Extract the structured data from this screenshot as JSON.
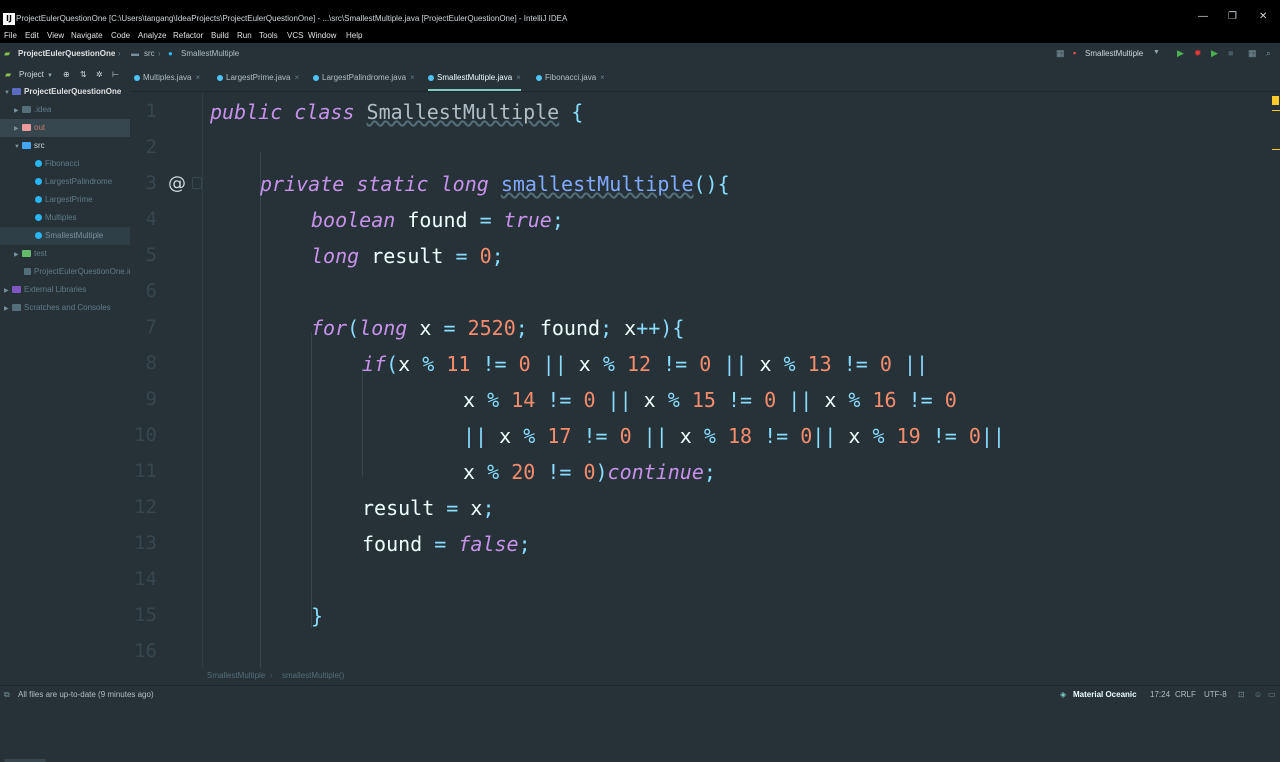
{
  "window": {
    "title": "ProjectEulerQuestionOne [C:\\Users\\tangang\\IdeaProjects\\ProjectEulerQuestionOne] - ...\\src\\SmallestMultiple.java [ProjectEulerQuestionOne] - IntelliJ IDEA",
    "controls": {
      "minimize": "—",
      "maximize": "❐",
      "close": "✕"
    }
  },
  "menu": [
    "File",
    "Edit",
    "View",
    "Navigate",
    "Code",
    "Analyze",
    "Refactor",
    "Build",
    "Run",
    "Tools",
    "VCS",
    "Window",
    "Help"
  ],
  "nav": {
    "project": "ProjectEulerQuestionOne",
    "folder": "src",
    "file": "SmallestMultiple",
    "run_config": "SmallestMultiple"
  },
  "sidebar": {
    "header": "Project",
    "tree": [
      {
        "label": "ProjectEulerQuestionOne",
        "type": "module",
        "level": 0,
        "expanded": true
      },
      {
        "label": ".idea",
        "type": "folder",
        "level": 1,
        "expanded": false
      },
      {
        "label": "out",
        "type": "folder-excluded",
        "level": 1,
        "expanded": false
      },
      {
        "label": "src",
        "type": "folder-src",
        "level": 1,
        "expanded": true
      },
      {
        "label": "Fibonacci",
        "type": "class",
        "level": 2
      },
      {
        "label": "LargestPalindrome",
        "type": "class",
        "level": 2
      },
      {
        "label": "LargestPrime",
        "type": "class",
        "level": 2
      },
      {
        "label": "Multiples",
        "type": "class",
        "level": 2
      },
      {
        "label": "SmallestMultiple",
        "type": "class",
        "level": 2,
        "selected": true
      },
      {
        "label": "test",
        "type": "folder-test",
        "level": 1,
        "expanded": false
      },
      {
        "label": "ProjectEulerQuestionOne.iml",
        "type": "file",
        "level": 1
      },
      {
        "label": "External Libraries",
        "type": "library",
        "level": 0,
        "expanded": false
      },
      {
        "label": "Scratches and Consoles",
        "type": "scratch",
        "level": 0,
        "expanded": false
      }
    ]
  },
  "tabs": [
    {
      "label": "Multiples.java",
      "active": false
    },
    {
      "label": "LargestPrime.java",
      "active": false
    },
    {
      "label": "LargestPalindrome.java",
      "active": false
    },
    {
      "label": "SmallestMultiple.java",
      "active": true
    },
    {
      "label": "Fibonacci.java",
      "active": false
    }
  ],
  "editor": {
    "line_numbers": [
      "1",
      "2",
      "3",
      "4",
      "5",
      "6",
      "7",
      "8",
      "9",
      "10",
      "11",
      "12",
      "13",
      "14",
      "15",
      "16"
    ],
    "gutter_marker": "@",
    "code": [
      [
        [
          "kw",
          "public class "
        ],
        [
          "cn",
          "SmallestMultiple"
        ],
        [
          "op",
          " {"
        ]
      ],
      [],
      [
        [
          "kw",
          "private static long "
        ],
        [
          "mn",
          "smallestMultiple"
        ],
        [
          "op",
          "(){"
        ]
      ],
      [
        [
          "kw",
          "boolean "
        ],
        [
          "t",
          "found "
        ],
        [
          "op",
          "= "
        ],
        [
          "kw",
          "true"
        ],
        [
          "op",
          ";"
        ]
      ],
      [
        [
          "kw",
          "long "
        ],
        [
          "t",
          "result "
        ],
        [
          "op",
          "= "
        ],
        [
          "num",
          "0"
        ],
        [
          "op",
          ";"
        ]
      ],
      [],
      [
        [
          "kw",
          "for"
        ],
        [
          "op",
          "("
        ],
        [
          "kw",
          "long "
        ],
        [
          "t",
          "x "
        ],
        [
          "op",
          "= "
        ],
        [
          "num",
          "2520"
        ],
        [
          "op",
          "; "
        ],
        [
          "t",
          "found"
        ],
        [
          "op",
          "; "
        ],
        [
          "t",
          "x"
        ],
        [
          "op",
          "++){"
        ]
      ],
      [
        [
          "kw",
          "if"
        ],
        [
          "op",
          "("
        ],
        [
          "t",
          "x "
        ],
        [
          "op",
          "% "
        ],
        [
          "num",
          "11 "
        ],
        [
          "op",
          "!= "
        ],
        [
          "num",
          "0 "
        ],
        [
          "op",
          "|| "
        ],
        [
          "t",
          "x "
        ],
        [
          "op",
          "% "
        ],
        [
          "num",
          "12 "
        ],
        [
          "op",
          "!= "
        ],
        [
          "num",
          "0 "
        ],
        [
          "op",
          "|| "
        ],
        [
          "t",
          "x "
        ],
        [
          "op",
          "% "
        ],
        [
          "num",
          "13 "
        ],
        [
          "op",
          "!= "
        ],
        [
          "num",
          "0 "
        ],
        [
          "op",
          "||"
        ]
      ],
      [
        [
          "t",
          "x "
        ],
        [
          "op",
          "% "
        ],
        [
          "num",
          "14 "
        ],
        [
          "op",
          "!= "
        ],
        [
          "num",
          "0 "
        ],
        [
          "op",
          "|| "
        ],
        [
          "t",
          "x "
        ],
        [
          "op",
          "% "
        ],
        [
          "num",
          "15 "
        ],
        [
          "op",
          "!= "
        ],
        [
          "num",
          "0 "
        ],
        [
          "op",
          "|| "
        ],
        [
          "t",
          "x "
        ],
        [
          "op",
          "% "
        ],
        [
          "num",
          "16 "
        ],
        [
          "op",
          "!= "
        ],
        [
          "num",
          "0"
        ]
      ],
      [
        [
          "op",
          "|| "
        ],
        [
          "t",
          "x "
        ],
        [
          "op",
          "% "
        ],
        [
          "num",
          "17 "
        ],
        [
          "op",
          "!= "
        ],
        [
          "num",
          "0 "
        ],
        [
          "op",
          "|| "
        ],
        [
          "t",
          "x "
        ],
        [
          "op",
          "% "
        ],
        [
          "num",
          "18 "
        ],
        [
          "op",
          "!= "
        ],
        [
          "num",
          "0"
        ],
        [
          "op",
          "|| "
        ],
        [
          "t",
          "x "
        ],
        [
          "op",
          "% "
        ],
        [
          "num",
          "19 "
        ],
        [
          "op",
          "!= "
        ],
        [
          "num",
          "0"
        ],
        [
          "op",
          "||"
        ]
      ],
      [
        [
          "t",
          "x "
        ],
        [
          "op",
          "% "
        ],
        [
          "num",
          "20 "
        ],
        [
          "op",
          "!= "
        ],
        [
          "num",
          "0"
        ],
        [
          "op",
          ")"
        ],
        [
          "kw",
          "continue"
        ],
        [
          "op",
          ";"
        ]
      ],
      [
        [
          "t",
          "result "
        ],
        [
          "op",
          "= "
        ],
        [
          "t",
          "x"
        ],
        [
          "op",
          ";"
        ]
      ],
      [
        [
          "t",
          "found "
        ],
        [
          "op",
          "= "
        ],
        [
          "kw",
          "false"
        ],
        [
          "op",
          ";"
        ]
      ],
      [],
      [
        [
          "op",
          "}"
        ]
      ],
      []
    ]
  },
  "breadcrumbs": [
    "SmallestMultiple",
    "smallestMultiple()"
  ],
  "status": {
    "message": "All files are up-to-date (9 minutes ago)",
    "theme": "Material Oceanic",
    "position": "17:24",
    "line_sep": "CRLF",
    "encoding": "UTF-8"
  },
  "colors": {
    "background": "#263238",
    "keyword": "#c792ea",
    "number": "#f78c6c",
    "operator": "#89ddff",
    "accent": "#80cbc4"
  }
}
